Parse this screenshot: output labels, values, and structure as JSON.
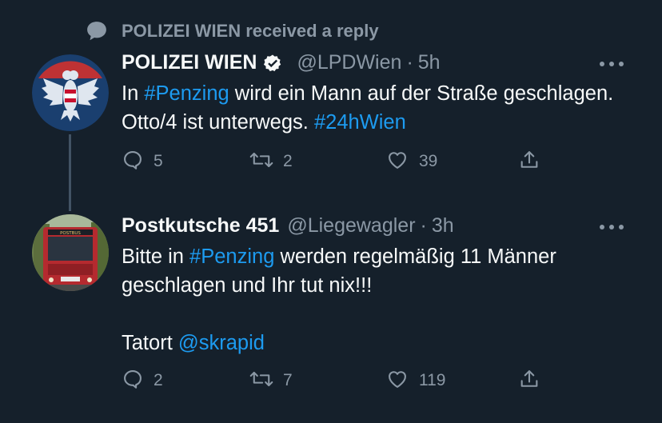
{
  "context": {
    "text": "POLIZEI WIEN received a reply",
    "icon": "speech-bubble-icon"
  },
  "tweets": [
    {
      "name": "POLIZEI WIEN",
      "verified": true,
      "handle": "@LPDWien",
      "dot": "·",
      "time": "5h",
      "body": [
        {
          "t": "In ",
          "link": false
        },
        {
          "t": "#Penzing",
          "link": true
        },
        {
          "t": " wird ein Mann auf der Straße geschlagen. Otto/4 ist unterwegs. ",
          "link": false
        },
        {
          "t": "#24hWien",
          "link": true
        }
      ],
      "counts": {
        "replies": "5",
        "retweets": "2",
        "likes": "39"
      }
    },
    {
      "name": "Postkutsche 451",
      "verified": false,
      "handle": "@Liegewagler",
      "dot": "·",
      "time": "3h",
      "body_p1": [
        {
          "t": "Bitte in ",
          "link": false
        },
        {
          "t": "#Penzing",
          "link": true
        },
        {
          "t": " werden regelmäßig 11 Männer geschlagen und Ihr tut nix!!!",
          "link": false
        }
      ],
      "body_p2": [
        {
          "t": "Tatort ",
          "link": false
        },
        {
          "t": "@skrapid",
          "link": true
        }
      ],
      "counts": {
        "replies": "2",
        "retweets": "7",
        "likes": "119"
      }
    }
  ],
  "colors": {
    "background": "#15202b",
    "text": "#f7f9f9",
    "muted": "#8b98a5",
    "link": "#1d9bf0",
    "verified": "#f7f9f9"
  },
  "avatar2_sign": "POSTBUS"
}
